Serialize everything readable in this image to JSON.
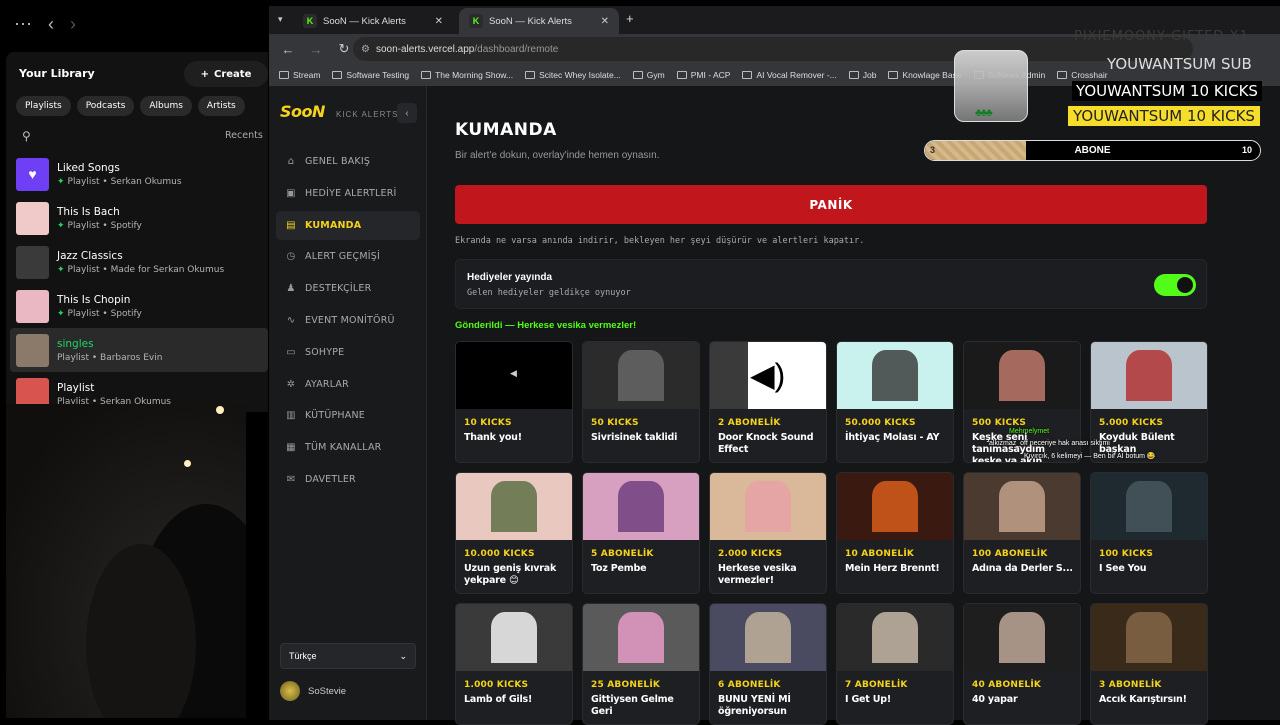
{
  "spotify": {
    "library_title": "Your Library",
    "create_label": "Create",
    "chips": [
      "Playlists",
      "Podcasts",
      "Albums",
      "Artists"
    ],
    "recents_label": "Recents",
    "items": [
      {
        "name": "Liked Songs",
        "sub": "Playlist • Serkan Okumus",
        "pinned": true,
        "color": "#6f3ff5"
      },
      {
        "name": "This Is Bach",
        "sub": "Playlist • Spotify",
        "pinned": true,
        "color": "#f0c9c9"
      },
      {
        "name": "Jazz Classics",
        "sub": "Playlist • Made for Serkan Okumus",
        "pinned": true,
        "color": "#3a3a3a"
      },
      {
        "name": "This Is Chopin",
        "sub": "Playlist • Spotify",
        "pinned": true,
        "color": "#e9b8c3"
      },
      {
        "name": "singles",
        "sub": "Playlist • Barbaros Evin",
        "pinned": false,
        "color": "#8b7a6a"
      },
      {
        "name": "Playlist",
        "sub": "Playlist • Serkan Okumus",
        "pinned": false,
        "color": "#d8544f"
      }
    ]
  },
  "browser": {
    "tabs": [
      {
        "title": "SooN — Kick Alerts"
      },
      {
        "title": "SooN — Kick Alerts"
      }
    ],
    "url_host": "soon-alerts.vercel.app",
    "url_path": "/dashboard/remote",
    "bookmarks": [
      "Stream",
      "Software Testing",
      "The Morning Show...",
      "Scitec Whey Isolate...",
      "Gym",
      "PMI - ACP",
      "AI Vocal Remover -...",
      "Job",
      "Knowlage Base",
      "SoNews Admin",
      "Crosshair"
    ]
  },
  "app": {
    "logo": "SooN",
    "logo_sub": "KICK ALERTS",
    "menu": [
      {
        "label": "GENEL BAKIŞ",
        "icon": "home-icon",
        "glyph": "⌂"
      },
      {
        "label": "HEDİYE ALERTLERİ",
        "icon": "gift-icon",
        "glyph": "▣"
      },
      {
        "label": "KUMANDA",
        "icon": "remote-icon",
        "glyph": "▤",
        "active": true
      },
      {
        "label": "ALERT GEÇMİŞİ",
        "icon": "history-icon",
        "glyph": "◷"
      },
      {
        "label": "DESTEKÇİLER",
        "icon": "users-icon",
        "glyph": "♟"
      },
      {
        "label": "EVENT MONİTÖRÜ",
        "icon": "activity-icon",
        "glyph": "∿"
      },
      {
        "label": "SOHYPE",
        "icon": "chat-icon",
        "glyph": "▭"
      },
      {
        "label": "AYARLAR",
        "icon": "gear-icon",
        "glyph": "✲"
      },
      {
        "label": "KÜTÜPHANE",
        "icon": "library-icon",
        "glyph": "▥"
      },
      {
        "label": "TÜM KANALLAR",
        "icon": "channels-icon",
        "glyph": "▦"
      },
      {
        "label": "DAVETLER",
        "icon": "invite-icon",
        "glyph": "✉"
      }
    ],
    "language": "Türkçe",
    "username": "SoStevie",
    "page_title": "KUMANDA",
    "page_subtitle": "Bir alert'e dokun, overlay'inde hemen oynasın.",
    "panic_label": "PANİK",
    "panic_desc": "Ekranda ne varsa anında indirir, bekleyen her şeyi düşürür ve alertleri kapatır.",
    "gifts_live_title": "Hediyeler yayında",
    "gifts_live_desc": "Gelen hediyeler geldikçe oynuyor",
    "gifts_live_on": true,
    "sent_message": "Gönderildi — Herkese vesika vermezler!",
    "cards": [
      {
        "kicks": "10 KICKS",
        "title": "Thank you!",
        "bg": "#000000",
        "accent": "#111111"
      },
      {
        "kicks": "50 KICKS",
        "title": "Sivrisinek taklidi",
        "bg": "#2b2b2b",
        "accent": "#6a6a6a"
      },
      {
        "kicks": "2 ABONELİK",
        "title": "Door Knock Sound Effect",
        "bg": "#3a3a3a",
        "accent": "#ffffff"
      },
      {
        "kicks": "50.000 KICKS",
        "title": "İhtiyaç Molası - AY",
        "bg": "#c9f2ef",
        "accent": "#333333"
      },
      {
        "kicks": "500 KICKS",
        "title": "Keşke seni tanımasaydım keşke ya akın kırıtsaydı",
        "bg": "#1a1a1a",
        "accent": "#c97d6e"
      },
      {
        "kicks": "5.000 KICKS",
        "title": "Koyduk Bülent başkan",
        "bg": "#b9c4cc",
        "accent": "#b22a2a"
      },
      {
        "kicks": "10.000 KICKS",
        "title": "Uzun geniş kıvrak yekpare 😊",
        "bg": "#e9c8c0",
        "accent": "#556b3f"
      },
      {
        "kicks": "5 ABONELİK",
        "title": "Toz Pembe",
        "bg": "#d8a0c0",
        "accent": "#6a3a7a"
      },
      {
        "kicks": "2.000 KICKS",
        "title": "Herkese vesika vermezler!",
        "bg": "#d9b99a",
        "accent": "#e8a0a8"
      },
      {
        "kicks": "10 ABONELİK",
        "title": "Mein Herz Brennt!",
        "bg": "#3a1a10",
        "accent": "#e0601a"
      },
      {
        "kicks": "100 ABONELİK",
        "title": "Adına da Derler S...",
        "bg": "#4a3a30",
        "accent": "#c8a890"
      },
      {
        "kicks": "100 KICKS",
        "title": "I See You",
        "bg": "#1e2a30",
        "accent": "#4a5a60"
      },
      {
        "kicks": "1.000 KICKS",
        "title": "Lamb of Gils!",
        "bg": "#3a3a3a",
        "accent": "#ffffff"
      },
      {
        "kicks": "25 ABONELİK",
        "title": "Gittiysen Gelme Geri",
        "bg": "#5a5a5a",
        "accent": "#f0a0d0"
      },
      {
        "kicks": "6 ABONELİK",
        "title": "BUNU YENİ Mİ öğreniyorsun",
        "bg": "#4a4a60",
        "accent": "#c8b8a0"
      },
      {
        "kicks": "7 ABONELİK",
        "title": "I Get Up!",
        "bg": "#2a2a2a",
        "accent": "#d0c0b0"
      },
      {
        "kicks": "40 ABONELİK",
        "title": "40 yapar",
        "bg": "#1e1e1e",
        "accent": "#c8b0a0"
      },
      {
        "kicks": "3 ABONELİK",
        "title": "Accık Karıştırsın!",
        "bg": "#3a2a1a",
        "accent": "#8a6a4a"
      }
    ]
  },
  "overlay": {
    "faint_text": "PIXIEMOONY  GIFTED X1",
    "sub_text": "YOUWANTSUM  SUB",
    "line1": "YOUWANTSUM  10 KICKS",
    "line2": "YOUWANTSUM  10 KICKS",
    "goal_label": "ABONE",
    "goal_current": 3,
    "goal_max": 10,
    "goal_current_text": "3",
    "goal_max_text": "10"
  },
  "chat": [
    {
      "text": "alkizmaz_off neceriye hak anası siktimi"
    },
    {
      "text": "Mehmelymet"
    },
    {
      "text": "Kıvırcık, 6 kelimeyi — Ben bir AI botum 😂"
    }
  ],
  "colors": {
    "accent_yellow": "#f5d31a",
    "panic_red": "#c0161c",
    "kick_green": "#53fc18"
  }
}
